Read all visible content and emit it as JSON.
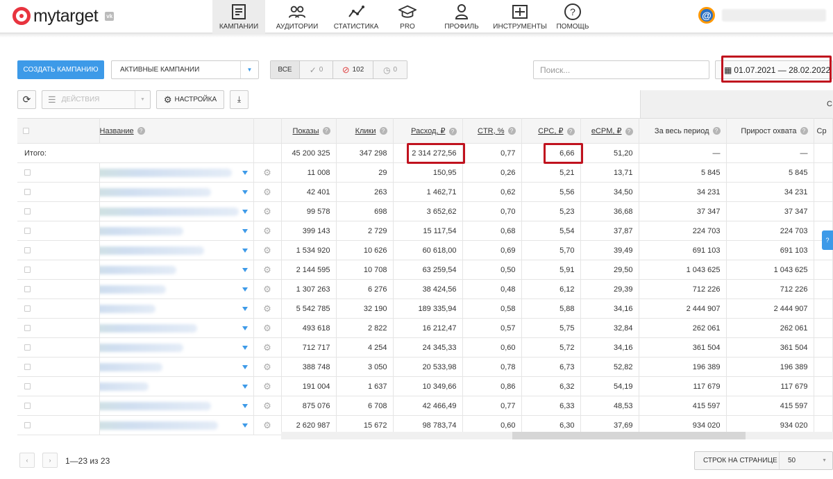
{
  "app": {
    "logo_text": "mytarget",
    "vk_badge": "vk"
  },
  "nav": [
    {
      "label": "КАМПАНИИ",
      "icon": "campaigns-icon",
      "active": true
    },
    {
      "label": "АУДИТОРИИ",
      "icon": "audiences-icon",
      "active": false
    },
    {
      "label": "СТАТИСТИКА",
      "icon": "statistics-icon",
      "active": false
    },
    {
      "label": "PRO",
      "icon": "graduation-cap-icon",
      "active": false
    },
    {
      "label": "ПРОФИЛЬ",
      "icon": "profile-icon",
      "active": false
    },
    {
      "label": "ИНСТРУМЕНТЫ",
      "icon": "tools-icon",
      "active": false
    },
    {
      "label": "ПОМОЩЬ",
      "icon": "help-icon",
      "active": false
    }
  ],
  "user": {
    "avatar": "@"
  },
  "toolbar": {
    "create_label": "СОЗДАТЬ КАМПАНИЮ",
    "status_select": "АКТИВНЫЕ КАМПАНИИ",
    "filter_all": "ВСЕ",
    "filter_active_count": "0",
    "filter_blocked_count": "102",
    "filter_pending_count": "0",
    "search_placeholder": "Поиск...",
    "date_range": "01.07.2021 — 28.02.2022",
    "actions_label": "ДЕЙСТВИЯ",
    "settings_label": "НАСТРОЙКА"
  },
  "table": {
    "group_head_right": "С",
    "columns": {
      "name": "Название",
      "shows": "Показы",
      "clicks": "Клики",
      "spend": "Расход, ₽",
      "ctr": "CTR, %",
      "cpc": "CPC, ₽",
      "ecpm": "eCPM, ₽",
      "period": "За весь период",
      "growth": "Прирост охвата",
      "avg": "Ср"
    },
    "total": {
      "label": "Итого:",
      "shows": "45 200 325",
      "clicks": "347 298",
      "spend": "2 314 272,56",
      "ctr": "0,77",
      "cpc": "6,66",
      "ecpm": "51,20",
      "period": "—",
      "growth": "—"
    },
    "rows": [
      {
        "shows": "11 008",
        "clicks": "29",
        "spend": "150,95",
        "ctr": "0,26",
        "cpc": "5,21",
        "ecpm": "13,71",
        "period": "5 845",
        "growth": "5 845"
      },
      {
        "shows": "42 401",
        "clicks": "263",
        "spend": "1 462,71",
        "ctr": "0,62",
        "cpc": "5,56",
        "ecpm": "34,50",
        "period": "34 231",
        "growth": "34 231"
      },
      {
        "shows": "99 578",
        "clicks": "698",
        "spend": "3 652,62",
        "ctr": "0,70",
        "cpc": "5,23",
        "ecpm": "36,68",
        "period": "37 347",
        "growth": "37 347"
      },
      {
        "shows": "399 143",
        "clicks": "2 729",
        "spend": "15 117,54",
        "ctr": "0,68",
        "cpc": "5,54",
        "ecpm": "37,87",
        "period": "224 703",
        "growth": "224 703"
      },
      {
        "shows": "1 534 920",
        "clicks": "10 626",
        "spend": "60 618,00",
        "ctr": "0,69",
        "cpc": "5,70",
        "ecpm": "39,49",
        "period": "691 103",
        "growth": "691 103"
      },
      {
        "shows": "2 144 595",
        "clicks": "10 708",
        "spend": "63 259,54",
        "ctr": "0,50",
        "cpc": "5,91",
        "ecpm": "29,50",
        "period": "1 043 625",
        "growth": "1 043 625"
      },
      {
        "shows": "1 307 263",
        "clicks": "6 276",
        "spend": "38 424,56",
        "ctr": "0,48",
        "cpc": "6,12",
        "ecpm": "29,39",
        "period": "712 226",
        "growth": "712 226"
      },
      {
        "shows": "5 542 785",
        "clicks": "32 190",
        "spend": "189 335,94",
        "ctr": "0,58",
        "cpc": "5,88",
        "ecpm": "34,16",
        "period": "2 444 907",
        "growth": "2 444 907"
      },
      {
        "shows": "493 618",
        "clicks": "2 822",
        "spend": "16 212,47",
        "ctr": "0,57",
        "cpc": "5,75",
        "ecpm": "32,84",
        "period": "262 061",
        "growth": "262 061"
      },
      {
        "shows": "712 717",
        "clicks": "4 254",
        "spend": "24 345,33",
        "ctr": "0,60",
        "cpc": "5,72",
        "ecpm": "34,16",
        "period": "361 504",
        "growth": "361 504"
      },
      {
        "shows": "388 748",
        "clicks": "3 050",
        "spend": "20 533,98",
        "ctr": "0,78",
        "cpc": "6,73",
        "ecpm": "52,82",
        "period": "196 389",
        "growth": "196 389"
      },
      {
        "shows": "191 004",
        "clicks": "1 637",
        "spend": "10 349,66",
        "ctr": "0,86",
        "cpc": "6,32",
        "ecpm": "54,19",
        "period": "117 679",
        "growth": "117 679"
      },
      {
        "shows": "875 076",
        "clicks": "6 708",
        "spend": "42 466,49",
        "ctr": "0,77",
        "cpc": "6,33",
        "ecpm": "48,53",
        "period": "415 597",
        "growth": "415 597"
      },
      {
        "shows": "2 620 987",
        "clicks": "15 672",
        "spend": "98 783,74",
        "ctr": "0,60",
        "cpc": "6,30",
        "ecpm": "37,69",
        "period": "934 020",
        "growth": "934 020"
      }
    ]
  },
  "pagination": {
    "info": "1—23 из 23",
    "rows_per_page_label": "СТРОК НА СТРАНИЦЕ",
    "rows_per_page_value": "50"
  },
  "side_tab": "?",
  "colors": {
    "accent": "#3d9ae8",
    "highlight": "#c0121e",
    "logo": "#e8343f"
  }
}
